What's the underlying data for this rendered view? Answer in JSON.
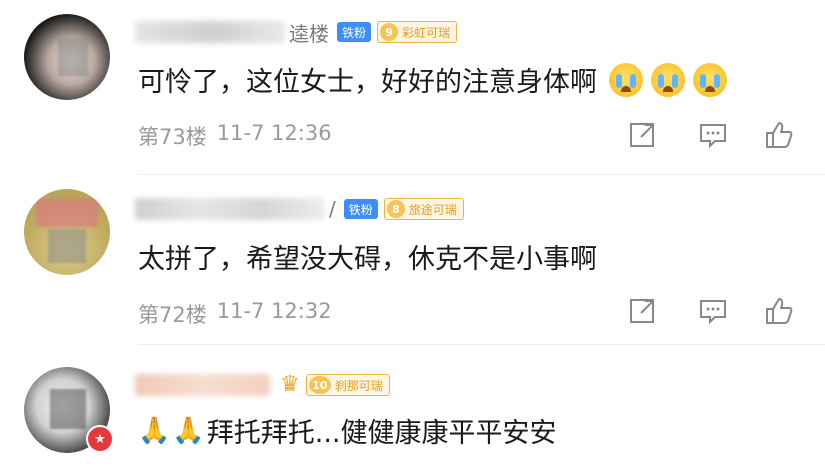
{
  "comments": [
    {
      "partial_name": "逵楼",
      "fan_tag": "铁粉",
      "level_num": "9",
      "level_label": "彩虹可瑞",
      "text": "可怜了，这位女士，好好的注意身体啊",
      "emoji_count": 3,
      "floor": "第73楼",
      "time": "11-7 12:36"
    },
    {
      "partial_name": "/",
      "fan_tag": "铁粉",
      "level_num": "8",
      "level_label": "旅途可瑞",
      "text": "太拼了，希望没大碍，休克不是小事啊",
      "emoji_count": 0,
      "floor": "第72楼",
      "time": "11-7 12:32"
    },
    {
      "partial_name": "",
      "fan_tag": "",
      "level_num": "10",
      "level_label": "刹那可瑞",
      "text": "拜托拜托...健健康康平平安安",
      "emoji_count": 0,
      "floor": "",
      "time": ""
    }
  ],
  "icons": {
    "share": "share-icon",
    "comment": "comment-icon",
    "like": "like-icon",
    "cry": "crying-face-emoji",
    "pray": "praying-hands-emoji",
    "crown": "crown-icon",
    "vip": "vip-badge-icon"
  },
  "colors": {
    "fan_tag_bg": "#3d8ff5",
    "level_tag_border": "#f3b240",
    "level_tag_text": "#e99a1a",
    "meta_text": "#9a9a9a",
    "vip_badge": "#e6383a"
  }
}
